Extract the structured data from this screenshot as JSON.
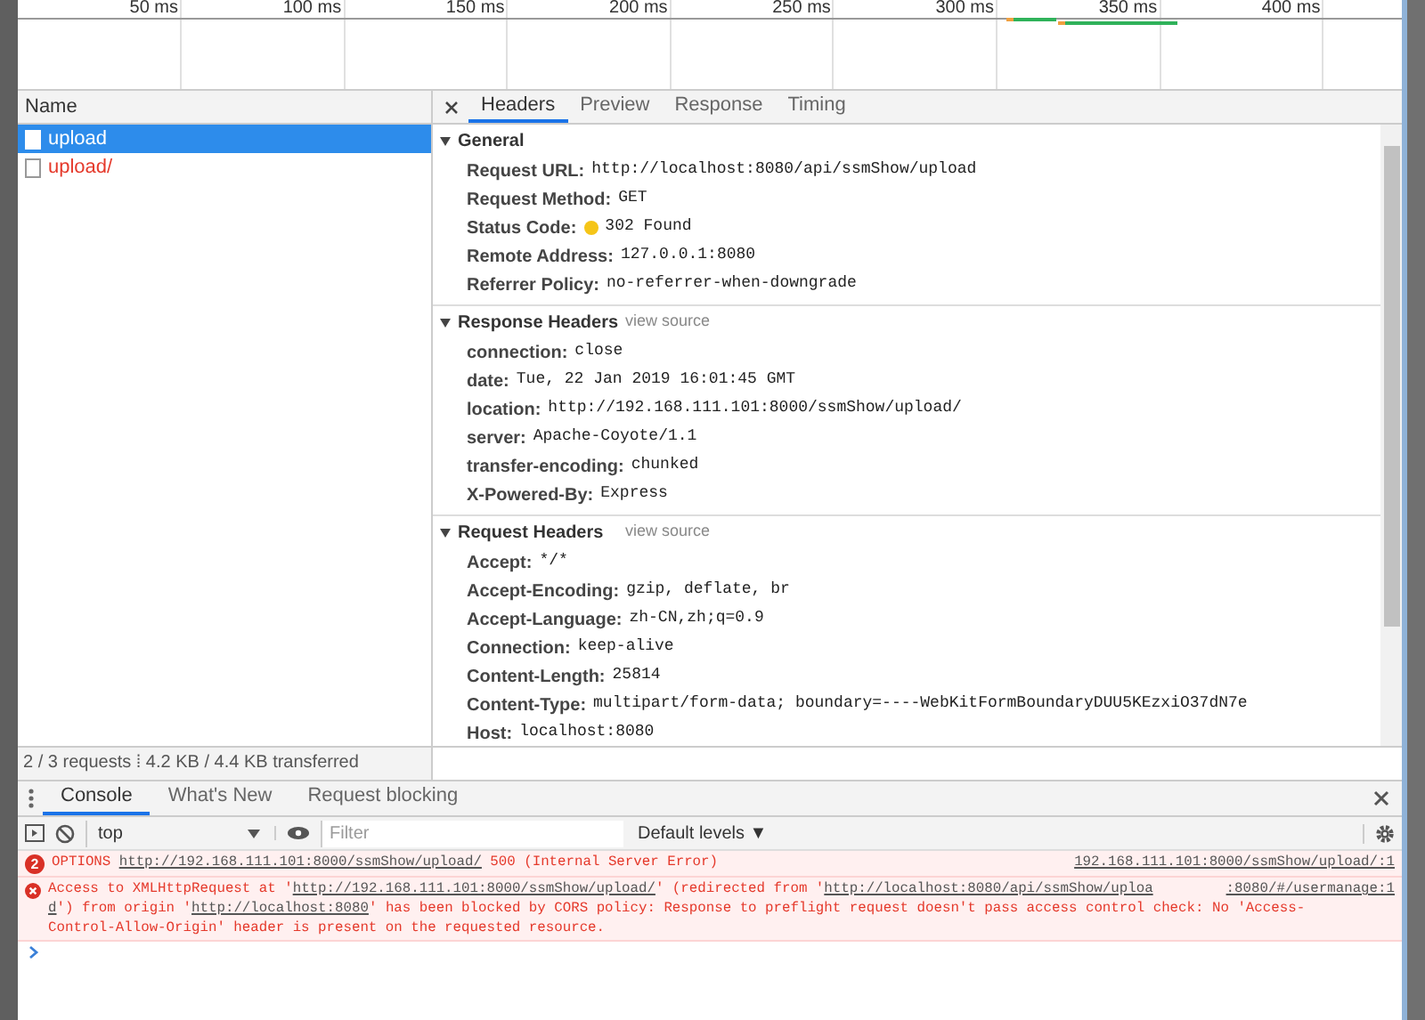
{
  "timeline": {
    "ticks": [
      "50 ms",
      "100 ms",
      "150 ms",
      "200 ms",
      "250 ms",
      "300 ms",
      "350 ms",
      "400 ms"
    ]
  },
  "requests": {
    "column": "Name",
    "items": [
      {
        "name": "upload",
        "selected": true,
        "failed": false
      },
      {
        "name": "upload/",
        "selected": false,
        "failed": true
      }
    ]
  },
  "detail_tabs": [
    {
      "label": "Headers",
      "selected": true
    },
    {
      "label": "Preview",
      "selected": false
    },
    {
      "label": "Response",
      "selected": false
    },
    {
      "label": "Timing",
      "selected": false
    }
  ],
  "sections": [
    {
      "title": "General",
      "expanded": true,
      "rows": [
        {
          "key": "Request URL:",
          "value": "http://localhost:8080/api/ssmShow/upload"
        },
        {
          "key": "Request Method:",
          "value": "GET"
        },
        {
          "key": "Status Code:",
          "value": "302 Found",
          "color": "#f5c518"
        },
        {
          "key": "Remote Address:",
          "value": "127.0.0.1:8080"
        },
        {
          "key": "Referrer Policy:",
          "value": "no-referrer-when-downgrade"
        }
      ]
    },
    {
      "title": "Response Headers",
      "expanded": true,
      "action": "view source",
      "rows": [
        {
          "key": "connection:",
          "value": "close"
        },
        {
          "key": "date:",
          "value": "Tue, 22 Jan 2019 16:01:45 GMT"
        },
        {
          "key": "location:",
          "value": "http://192.168.111.101:8000/ssmShow/upload/"
        },
        {
          "key": "server:",
          "value": "Apache-Coyote/1.1"
        },
        {
          "key": "transfer-encoding:",
          "value": "chunked"
        },
        {
          "key": "X-Powered-By:",
          "value": "Express"
        }
      ]
    },
    {
      "title": "Request Headers",
      "expanded": true,
      "action": "view source",
      "rows": [
        {
          "key": "Accept:",
          "value": "*/*"
        },
        {
          "key": "Accept-Encoding:",
          "value": "gzip, deflate, br"
        },
        {
          "key": "Accept-Language:",
          "value": "zh-CN,zh;q=0.9"
        },
        {
          "key": "Connection:",
          "value": "keep-alive"
        },
        {
          "key": "Content-Length:",
          "value": "25814"
        },
        {
          "key": "Content-Type:",
          "value": "multipart/form-data; boundary=----WebKitFormBoundaryDUU5KEzxiO37dN7e"
        },
        {
          "key": "Host:",
          "value": "localhost:8080"
        }
      ]
    }
  ],
  "status_bar": "2 / 3 requests ⁞ 4.2 KB / 4.4 KB transferred",
  "drawer_tabs": [
    {
      "label": "Console",
      "selected": true
    },
    {
      "label": "What's New",
      "selected": false
    },
    {
      "label": "Request blocking",
      "selected": false
    }
  ],
  "console_toolbar": {
    "context": "top",
    "filter_placeholder": "Filter",
    "levels": "Default levels ▼"
  },
  "messages": [
    {
      "count": "2",
      "source": "192.168.111.101:8000/ssmShow/upload/:1",
      "lines": [
        [
          {
            "kind": "text",
            "text": "OPTIONS"
          },
          {
            "kind": "link",
            "text": "http://192.168.111.101:8000/ssmShow/upload/"
          },
          {
            "kind": "text",
            "text": "500 (Internal Server Error)"
          }
        ]
      ]
    },
    {
      "source": ":8080/#/usermanage:1",
      "lines": [
        [
          {
            "kind": "text",
            "text": "Access to XMLHttpRequest at '"
          },
          {
            "kind": "link",
            "text": "http://192.168.111.101:8000/ssmShow/upload/"
          },
          {
            "kind": "text",
            "text": "' (redirected from '"
          },
          {
            "kind": "link",
            "text": "http://localhost:8080/api/ssmShow/uploa"
          }
        ],
        [
          {
            "kind": "link",
            "text": "d"
          },
          {
            "kind": "text",
            "text": "') from origin '"
          },
          {
            "kind": "link",
            "text": "http://localhost:8080"
          },
          {
            "kind": "text",
            "text": "' has been blocked by CORS policy: Response to preflight request doesn't pass access control check: No 'Access-"
          }
        ],
        [
          {
            "kind": "text",
            "text": "Control-Allow-Origin' header is present on the requested resource."
          }
        ]
      ]
    }
  ]
}
